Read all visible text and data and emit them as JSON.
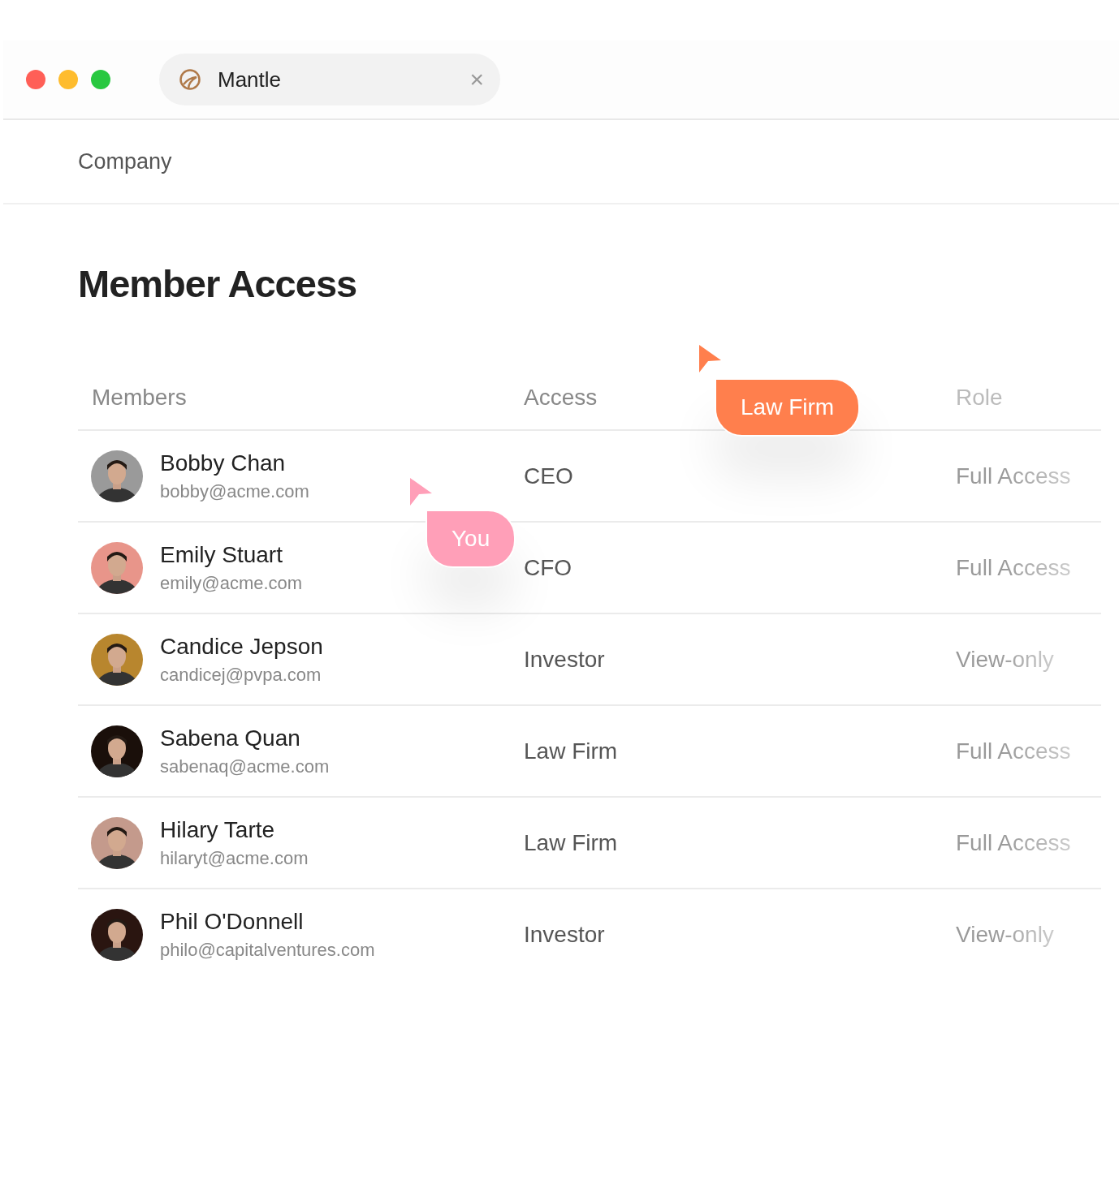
{
  "window": {
    "controls": [
      {
        "color": "#ff5f57"
      },
      {
        "color": "#febc2e"
      },
      {
        "color": "#28c840"
      }
    ]
  },
  "tab": {
    "title": "Mantle",
    "close": "×"
  },
  "breadcrumb": "Company",
  "heading": "Member Access",
  "table": {
    "columns": [
      "Members",
      "Access",
      "Role"
    ],
    "rows": [
      {
        "name": "Bobby Chan",
        "email": "bobby@acme.com",
        "access": "CEO",
        "role": "Full Access"
      },
      {
        "name": "Emily Stuart",
        "email": "emily@acme.com",
        "access": "CFO",
        "role": "Full Access"
      },
      {
        "name": "Candice Jepson",
        "email": "candicej@pvpa.com",
        "access": "Investor",
        "role": "View-only"
      },
      {
        "name": "Sabena Quan",
        "email": "sabenaq@acme.com",
        "access": "Law Firm",
        "role": "Full Access"
      },
      {
        "name": "Hilary Tarte",
        "email": "hilaryt@acme.com",
        "access": "Law Firm",
        "role": "Full Access"
      },
      {
        "name": "Phil O'Donnell",
        "email": "philo@capitalventures.com",
        "access": "Investor",
        "role": "View-only"
      }
    ]
  },
  "cursors": [
    {
      "label": "Law Firm",
      "color": "#ff7f4d"
    },
    {
      "label": "You",
      "color": "#ff9fb8"
    }
  ]
}
